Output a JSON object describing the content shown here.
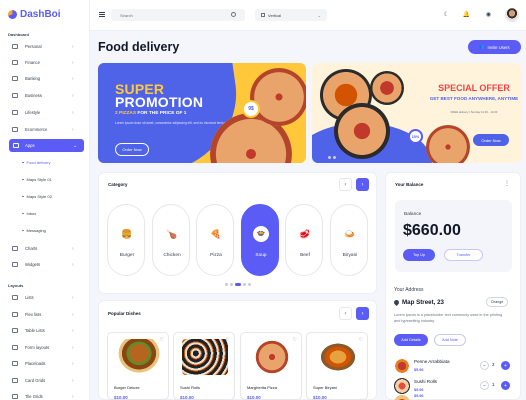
{
  "app": {
    "name": "DashBoi"
  },
  "sidebar": {
    "dashboard_header": "Dashboard",
    "items": [
      {
        "label": "Personal",
        "chev": "›"
      },
      {
        "label": "Finance",
        "chev": "›"
      },
      {
        "label": "Banking",
        "chev": "›"
      },
      {
        "label": "Business",
        "chev": "›"
      },
      {
        "label": "Lifestyle",
        "chev": "›"
      },
      {
        "label": "Ecommerce",
        "chev": "›"
      },
      {
        "label": "Apps",
        "chev": "⌄"
      }
    ],
    "apps_sub": [
      "Food delivery",
      "Maps Style 01",
      "Maps Style 02",
      "Inbox",
      "Messaging"
    ],
    "items2": [
      {
        "label": "Charts",
        "chev": "›"
      },
      {
        "label": "Widgets",
        "chev": "›"
      }
    ],
    "layouts_header": "Layouts",
    "items3": [
      {
        "label": "Lists",
        "chev": "›"
      },
      {
        "label": "Flex lists",
        "chev": "›"
      },
      {
        "label": "Table Lists",
        "chev": "›"
      },
      {
        "label": "Form layouts",
        "chev": "›"
      },
      {
        "label": "Placeloads",
        "chev": "›"
      },
      {
        "label": "Card Grids",
        "chev": "›"
      },
      {
        "label": "Tile Grids",
        "chev": "›"
      }
    ]
  },
  "topbar": {
    "search_placeholder": "Search",
    "layout_label": "Vertical"
  },
  "page": {
    "title": "Food delivery",
    "invite_label": "Invite Users"
  },
  "banner1": {
    "title1": "SUPER",
    "title2": "PROMOTION",
    "sub_pre": "2 PIZZAS",
    "sub_post": " FOR THE PRICE OF 1",
    "desc": "Lorem ipsum dolor sit amet, consectetur adipiscing elit, sed do eiusmod tempor",
    "button": "Order Now",
    "price": "9$"
  },
  "banner2": {
    "title": "SPECIAL OFFER",
    "sub": "GET BEST FOOD ANYWHERE, ANYTIME",
    "small": "FREE delivery | Sunday 11:00 - 14:00",
    "badge": "15%",
    "button": "Order Now"
  },
  "category": {
    "title": "Category",
    "items": [
      {
        "label": "Burger",
        "icon": "🍔"
      },
      {
        "label": "Chicken",
        "icon": "🍗"
      },
      {
        "label": "Pizza",
        "icon": "🍕"
      },
      {
        "label": "Soup",
        "icon": "🍲"
      },
      {
        "label": "Beef",
        "icon": "🥩"
      },
      {
        "label": "Biryani",
        "icon": "🍛"
      }
    ]
  },
  "popular": {
    "title": "Popular Dishes",
    "items": [
      {
        "name": "Burger Deluxe",
        "price": "$10.00"
      },
      {
        "name": "Sushi Rolls",
        "price": "$10.00"
      },
      {
        "name": "Margherita Pizza",
        "price": "$10.00"
      },
      {
        "name": "Super Biryani",
        "price": "$10.00"
      }
    ]
  },
  "balance": {
    "title": "Your Balance",
    "label": "Balance",
    "amount": "$660.00",
    "topup": "Top Up",
    "transfer": "Transfer"
  },
  "address": {
    "header": "Your Address",
    "street": "Map Street, 23",
    "change": "Change",
    "desc": "Lorem ipsum is a placeholder text commonly used in the printing and typesetting industry.",
    "add_details": "Add Details",
    "add_note": "Add Note"
  },
  "orders": [
    {
      "name": "Penne Arrabbiata",
      "price": "$5.96",
      "qty": "2"
    },
    {
      "name": "Sushi Rolls",
      "price": "$5.96",
      "qty": "1"
    },
    {
      "name": "",
      "price": "$5.96",
      "qty": ""
    }
  ]
}
